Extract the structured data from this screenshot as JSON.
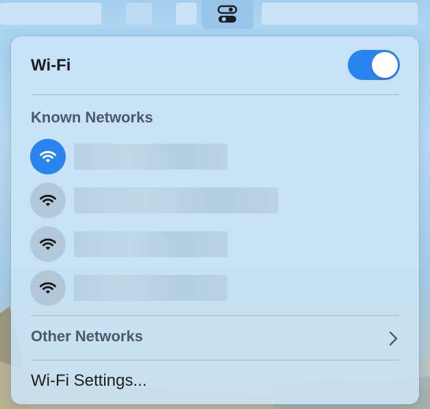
{
  "panel": {
    "title": "Wi-Fi",
    "toggle_on": true,
    "known_networks_header": "Known Networks",
    "networks": [
      {
        "name": "",
        "connected": true
      },
      {
        "name": "",
        "connected": false
      },
      {
        "name": "",
        "connected": false
      },
      {
        "name": "",
        "connected": false
      }
    ],
    "other_networks_label": "Other Networks",
    "settings_label": "Wi-Fi Settings..."
  },
  "icons": {
    "control_center": "control-center-toggles-icon",
    "wifi": "wifi-icon",
    "chevron": "chevron-right-icon"
  },
  "colors": {
    "accent": "#2a84f0",
    "title_text": "#1c1d1f",
    "section_text": "#4d5a66"
  }
}
